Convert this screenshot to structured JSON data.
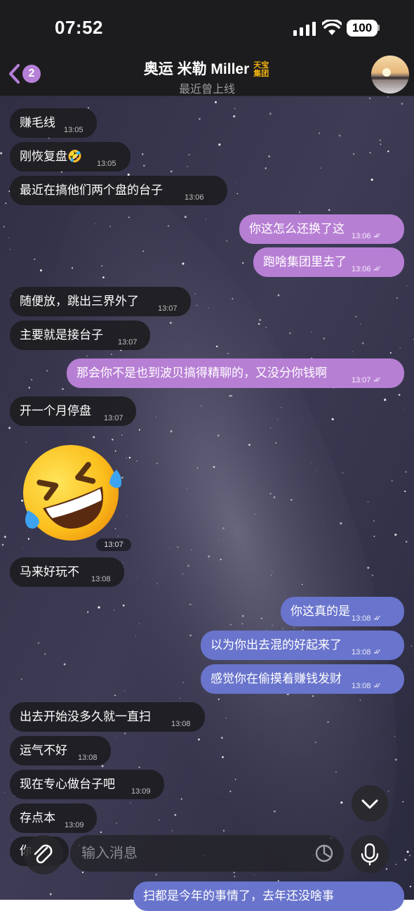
{
  "status": {
    "time": "07:52",
    "battery": "100"
  },
  "header": {
    "badge": "2",
    "title": "奥运 米勒 Miller",
    "logo_line1": "天宝",
    "logo_line2": "集团",
    "subtitle": "最近曾上线"
  },
  "messages": [
    {
      "text": "赚毛线",
      "time": "13:05"
    },
    {
      "text": "刚恢复盘🤣",
      "time": "13:05"
    },
    {
      "text": "最近在搞他们两个盘的台子",
      "time": "13:06"
    },
    {
      "text": "你这怎么还换了这",
      "time": "13:06"
    },
    {
      "text": "跑啥集团里去了",
      "time": "13:06"
    },
    {
      "text": "随便放，跳出三界外了",
      "time": "13:07"
    },
    {
      "text": "主要就是接台子",
      "time": "13:07"
    },
    {
      "text": "那会你不是也到波贝搞得精聊的，又没分你钱啊",
      "time": "13:07"
    },
    {
      "text": "开一个月停盘",
      "time": "13:07"
    },
    {
      "text": "",
      "time": "13:07"
    },
    {
      "text": "马来好玩不",
      "time": "13:08"
    },
    {
      "text": "你这真的是",
      "time": "13:08"
    },
    {
      "text": "以为你出去混的好起来了",
      "time": "13:08"
    },
    {
      "text": "感觉你在偷摸着赚钱发财",
      "time": "13:08"
    },
    {
      "text": "出去开始没多久就一直扫",
      "time": "13:08"
    },
    {
      "text": "运气不好",
      "time": "13:08"
    },
    {
      "text": "现在专心做台子吧",
      "time": "13:09"
    },
    {
      "text": "存点本",
      "time": "13:09"
    },
    {
      "text": "你",
      "time": ""
    },
    {
      "text": "扫都是今年的事情了，去年还没啥事",
      "time": ""
    }
  ],
  "composer": {
    "placeholder": "输入消息"
  },
  "colors": {
    "outgoing_purple": "#b77fd4",
    "outgoing_blue": "#6974cc",
    "incoming": "#1e1e22",
    "badge": "#b67fd8",
    "logo": "#f2b30e"
  },
  "icons": [
    "back-chevron-icon",
    "signal-icon",
    "wifi-icon",
    "battery-icon",
    "paperclip-icon",
    "sticker-icon",
    "microphone-icon",
    "chevron-down-icon",
    "read-checkmarks-icon"
  ]
}
